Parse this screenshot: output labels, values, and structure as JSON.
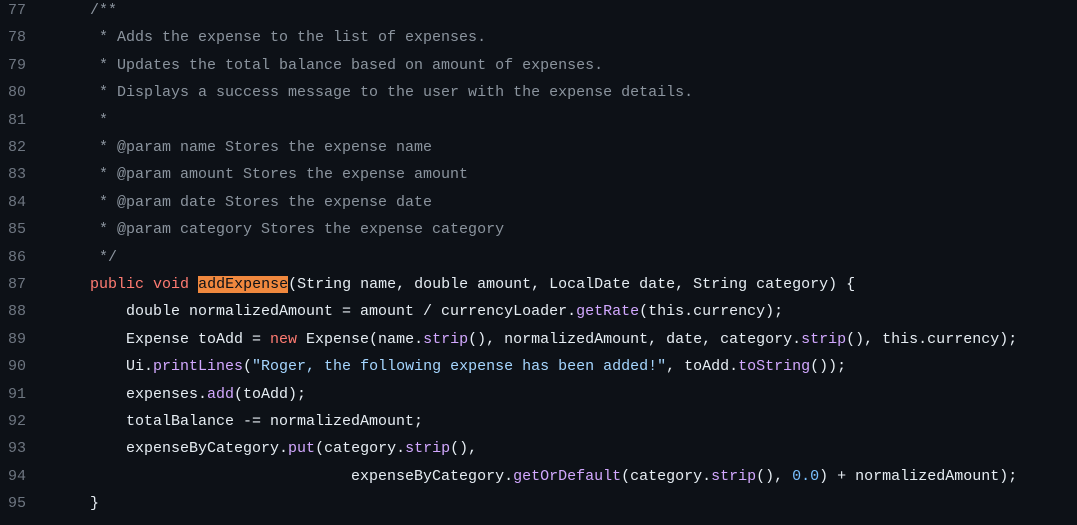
{
  "code": {
    "lines": [
      {
        "num": "77",
        "tokens": [
          {
            "t": "/**",
            "c": "comment"
          }
        ]
      },
      {
        "num": "78",
        "tokens": [
          {
            "t": " * Adds the expense to the list of expenses.",
            "c": "comment"
          }
        ]
      },
      {
        "num": "79",
        "tokens": [
          {
            "t": " * Updates the total balance based on amount of expenses.",
            "c": "comment"
          }
        ]
      },
      {
        "num": "80",
        "tokens": [
          {
            "t": " * Displays a success message to the user with the expense details.",
            "c": "comment"
          }
        ]
      },
      {
        "num": "81",
        "tokens": [
          {
            "t": " *",
            "c": "comment"
          }
        ]
      },
      {
        "num": "82",
        "tokens": [
          {
            "t": " * @param name Stores the expense name",
            "c": "comment"
          }
        ]
      },
      {
        "num": "83",
        "tokens": [
          {
            "t": " * @param amount Stores the expense amount",
            "c": "comment"
          }
        ]
      },
      {
        "num": "84",
        "tokens": [
          {
            "t": " * @param date Stores the expense date",
            "c": "comment"
          }
        ]
      },
      {
        "num": "85",
        "tokens": [
          {
            "t": " * @param category Stores the expense category",
            "c": "comment"
          }
        ]
      },
      {
        "num": "86",
        "tokens": [
          {
            "t": " */",
            "c": "comment"
          }
        ]
      },
      {
        "num": "87",
        "tokens": [
          {
            "t": "public",
            "c": "keyword"
          },
          {
            "t": " ",
            "c": "plain"
          },
          {
            "t": "void",
            "c": "keyword"
          },
          {
            "t": " ",
            "c": "plain"
          },
          {
            "t": "addExpense",
            "c": "highlight"
          },
          {
            "t": "(String name, double amount, LocalDate date, String category) {",
            "c": "plain"
          }
        ]
      },
      {
        "num": "88",
        "tokens": [
          {
            "t": "    double normalizedAmount = amount / currencyLoader.",
            "c": "plain"
          },
          {
            "t": "getRate",
            "c": "method"
          },
          {
            "t": "(this.currency);",
            "c": "plain"
          }
        ]
      },
      {
        "num": "89",
        "tokens": [
          {
            "t": "    Expense toAdd = ",
            "c": "plain"
          },
          {
            "t": "new",
            "c": "keyword"
          },
          {
            "t": " Expense(name.",
            "c": "plain"
          },
          {
            "t": "strip",
            "c": "method"
          },
          {
            "t": "(), normalizedAmount, date, category.",
            "c": "plain"
          },
          {
            "t": "strip",
            "c": "method"
          },
          {
            "t": "(), this.currency);",
            "c": "plain"
          }
        ]
      },
      {
        "num": "90",
        "tokens": [
          {
            "t": "    Ui.",
            "c": "plain"
          },
          {
            "t": "printLines",
            "c": "method"
          },
          {
            "t": "(",
            "c": "plain"
          },
          {
            "t": "\"Roger, the following expense has been added!\"",
            "c": "string"
          },
          {
            "t": ", toAdd.",
            "c": "plain"
          },
          {
            "t": "toString",
            "c": "method"
          },
          {
            "t": "());",
            "c": "plain"
          }
        ]
      },
      {
        "num": "91",
        "tokens": [
          {
            "t": "    expenses.",
            "c": "plain"
          },
          {
            "t": "add",
            "c": "method"
          },
          {
            "t": "(toAdd);",
            "c": "plain"
          }
        ]
      },
      {
        "num": "92",
        "tokens": [
          {
            "t": "    totalBalance -= normalizedAmount;",
            "c": "plain"
          }
        ]
      },
      {
        "num": "93",
        "tokens": [
          {
            "t": "    expenseByCategory.",
            "c": "plain"
          },
          {
            "t": "put",
            "c": "method"
          },
          {
            "t": "(category.",
            "c": "plain"
          },
          {
            "t": "strip",
            "c": "method"
          },
          {
            "t": "(),",
            "c": "plain"
          }
        ]
      },
      {
        "num": "94",
        "tokens": [
          {
            "t": "                             expenseByCategory.",
            "c": "plain"
          },
          {
            "t": "getOrDefault",
            "c": "method"
          },
          {
            "t": "(category.",
            "c": "plain"
          },
          {
            "t": "strip",
            "c": "method"
          },
          {
            "t": "(), ",
            "c": "plain"
          },
          {
            "t": "0.0",
            "c": "number"
          },
          {
            "t": ") + normalizedAmount);",
            "c": "plain"
          }
        ]
      },
      {
        "num": "95",
        "tokens": [
          {
            "t": "}",
            "c": "plain"
          }
        ]
      }
    ]
  }
}
